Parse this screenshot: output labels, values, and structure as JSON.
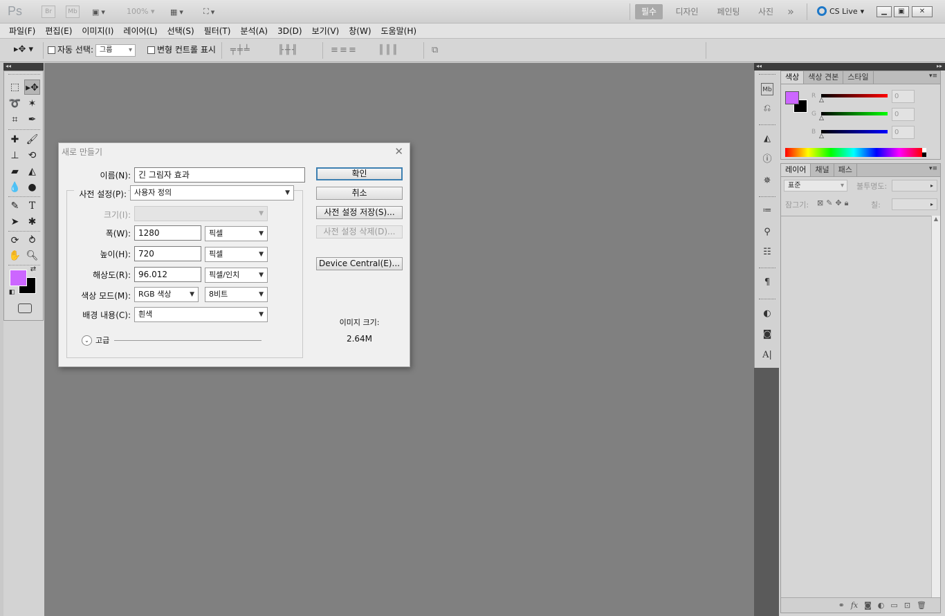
{
  "app": {
    "logo": "Ps",
    "bridge": "Br",
    "minibridge": "Mb",
    "zoom": "100%",
    "workspaces": [
      "필수",
      "디자인",
      "페인팅",
      "사진"
    ],
    "more": "»",
    "cs_live": "CS Live",
    "win_min": "▁",
    "win_max": "▣",
    "win_close": "✕"
  },
  "menu": [
    "파일(F)",
    "편집(E)",
    "이미지(I)",
    "레이어(L)",
    "선택(S)",
    "필터(T)",
    "분석(A)",
    "3D(D)",
    "보기(V)",
    "창(W)",
    "도움말(H)"
  ],
  "options": {
    "tool_glyph": "▸✥ ▾",
    "auto_select_label": "자동 선택:",
    "auto_select_value": "그룹",
    "show_transform_label": "변형 컨트롤 표시",
    "align_glyphs_1": "╤ ╪ ╧",
    "align_glyphs_2": "╟ ╫ ╢",
    "distribute_glyphs_1": "≡ ≡ ≡",
    "distribute_glyphs_2": "║ ║ ║",
    "auto_align_glyph": "⧉"
  },
  "colors": {
    "foreground": "#cc66ff",
    "background": "#000000",
    "canvas": "#808080"
  },
  "color_panel": {
    "tabs": [
      "색상",
      "색상 견본",
      "스타일"
    ],
    "channels": [
      {
        "letter": "R",
        "value": "0"
      },
      {
        "letter": "G",
        "value": "0"
      },
      {
        "letter": "B",
        "value": "0"
      }
    ]
  },
  "layers_panel": {
    "tabs": [
      "레이어",
      "채널",
      "패스"
    ],
    "blend_mode": "표준",
    "opacity_label": "불투명도:",
    "lock_label": "잠그기:",
    "fill_label": "칠:"
  },
  "dialog": {
    "title": "새로 만들기",
    "name_label": "이름(N):",
    "name_value": "긴 그림자 효과",
    "preset_label": "사전 설정(P):",
    "preset_value": "사용자 정의",
    "size_label": "크기(I):",
    "width_label": "폭(W):",
    "width_value": "1280",
    "width_unit": "픽셀",
    "height_label": "높이(H):",
    "height_value": "720",
    "height_unit": "픽셀",
    "resolution_label": "해상도(R):",
    "resolution_value": "96.012",
    "resolution_unit": "픽셀/인치",
    "color_mode_label": "색상 모드(M):",
    "color_mode_value": "RGB 색상",
    "bit_depth": "8비트",
    "background_label": "배경 내용(C):",
    "background_value": "흰색",
    "advanced_label": "고급",
    "ok": "확인",
    "cancel": "취소",
    "save_preset": "사전 설정 저장(S)...",
    "delete_preset": "사전 설정 삭제(D)...",
    "device_central": "Device Central(E)...",
    "image_size_label": "이미지 크기:",
    "image_size_value": "2.64M"
  }
}
